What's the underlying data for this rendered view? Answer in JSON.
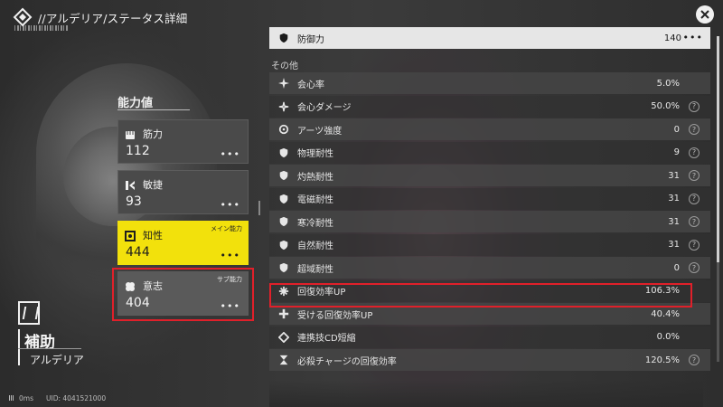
{
  "header": {
    "title": "//アルデリア/ステータス詳細"
  },
  "character": {
    "class_name": "補助",
    "name": "アルデリア"
  },
  "stats": {
    "heading": "能力値",
    "cards": [
      {
        "label": "筋力",
        "value": "112",
        "icon": "fist-icon",
        "tag": ""
      },
      {
        "label": "敏捷",
        "value": "93",
        "icon": "agility-icon",
        "tag": ""
      },
      {
        "label": "知性",
        "value": "444",
        "icon": "intellect-icon",
        "tag": "メイン能力"
      },
      {
        "label": "意志",
        "value": "404",
        "icon": "will-icon",
        "tag": "サブ能力"
      }
    ],
    "more_label": "•••"
  },
  "attributes": {
    "defense": {
      "label": "防御力",
      "value": "140",
      "icon": "shield-icon"
    },
    "section_label": "その他",
    "rows": [
      {
        "label": "会心率",
        "value": "5.0%",
        "icon": "crit-icon",
        "help": false
      },
      {
        "label": "会心ダメージ",
        "value": "50.0%",
        "icon": "crit-damage-icon",
        "help": true
      },
      {
        "label": "アーツ強度",
        "value": "0",
        "icon": "arts-icon",
        "help": true
      },
      {
        "label": "物理耐性",
        "value": "9",
        "icon": "physical-res-icon",
        "help": true
      },
      {
        "label": "灼熱耐性",
        "value": "31",
        "icon": "heat-res-icon",
        "help": true
      },
      {
        "label": "電磁耐性",
        "value": "31",
        "icon": "electric-res-icon",
        "help": true
      },
      {
        "label": "寒冷耐性",
        "value": "31",
        "icon": "cold-res-icon",
        "help": true
      },
      {
        "label": "自然耐性",
        "value": "31",
        "icon": "nature-res-icon",
        "help": true
      },
      {
        "label": "超域耐性",
        "value": "0",
        "icon": "aether-res-icon",
        "help": true
      },
      {
        "label": "回復効率UP",
        "value": "106.3%",
        "icon": "heal-icon",
        "help": false
      },
      {
        "label": "受ける回復効率UP",
        "value": "40.4%",
        "icon": "heal-received-icon",
        "help": false
      },
      {
        "label": "連携技CD短縮",
        "value": "0.0%",
        "icon": "combo-cd-icon",
        "help": false
      },
      {
        "label": "必殺チャージの回復効率",
        "value": "120.5%",
        "icon": "hourglass-icon",
        "help": true
      }
    ],
    "help_glyph": "?"
  },
  "footer": {
    "ping": "0ms",
    "uid": "UID: 4041521000"
  },
  "colors": {
    "main_stat_accent": "#f2e10c",
    "highlight": "#e0202a"
  }
}
